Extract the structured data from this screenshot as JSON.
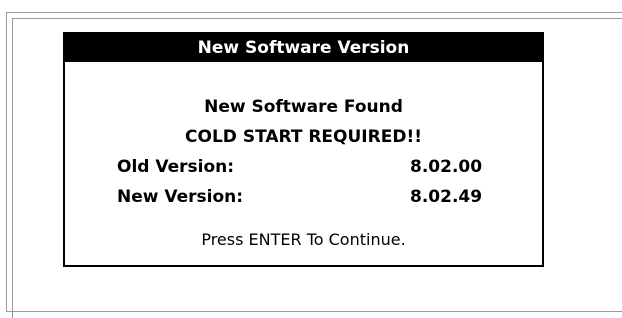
{
  "dialog": {
    "title": "New Software Version",
    "message_line_1": "New Software Found",
    "message_line_2": "COLD START REQUIRED!!",
    "old_version_label": "Old Version:",
    "old_version_value": "8.02.00",
    "new_version_label": "New Version:",
    "new_version_value": "8.02.49",
    "continue_prompt": "Press ENTER To Continue."
  }
}
